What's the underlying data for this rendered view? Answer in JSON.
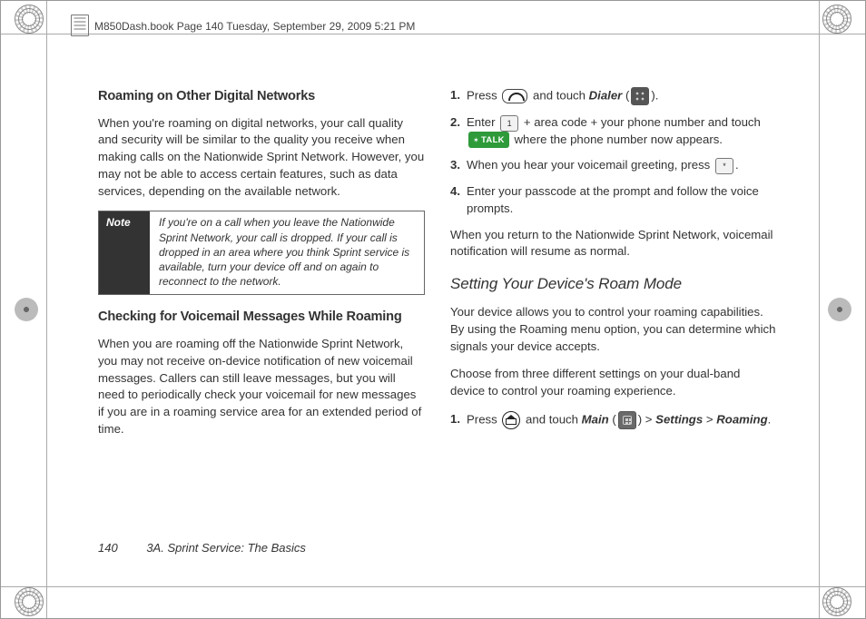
{
  "header": "M850Dash.book  Page 140  Tuesday, September 29, 2009  5:21 PM",
  "page_number": "140",
  "chapter": "3A. Sprint Service: The Basics",
  "left": {
    "h1": "Roaming on Other Digital Networks",
    "p1": "When you're roaming on digital networks, your call quality and security will be similar to the quality you receive when making calls on the Nationwide Sprint Network. However, you may not be able to access certain features, such as data services, depending on the available network.",
    "note_label": "Note",
    "note_text": "If you're on a call when you leave the Nationwide Sprint Network, your call is dropped. If your call is dropped in an area where you think Sprint service is available, turn your device off and on again to reconnect to the network.",
    "h2": "Checking for Voicemail Messages While Roaming",
    "p2": "When you are roaming off the Nationwide Sprint Network, you may not receive on-device notification of new voicemail messages. Callers can still leave messages, but you will need to periodically check your voicemail for new messages if you are in a roaming service area for an extended period of time."
  },
  "right": {
    "step1_a": "Press ",
    "step1_b": " and touch ",
    "step1_dialer": "Dialer",
    "step1_c": " (",
    "step1_d": ").",
    "step2_a": "Enter ",
    "step2_b": " + area code + your phone number and touch ",
    "step2_talk": "TALK",
    "step2_c": " where the phone number now appears.",
    "step3_a": "When you hear your voicemail greeting, press ",
    "step3_key": "*",
    "step3_b": ".",
    "step4": "Enter your passcode at the prompt and follow the voice prompts.",
    "p_after": "When you return to the Nationwide Sprint Network, voicemail notification will resume as normal.",
    "h3": "Setting Your Device's Roam Mode",
    "p3": "Your device allows you to control your roaming capabilities. By using the Roaming menu option, you can determine which signals your device accepts.",
    "p4": "Choose from three different settings on your dual-band device to control your roaming experience.",
    "r_step1_a": "Press ",
    "r_step1_b": " and touch ",
    "r_step1_main": "Main",
    "r_step1_c": " (",
    "r_step1_d": ") > ",
    "r_step1_settings": "Settings",
    "r_step1_e": " > ",
    "r_step1_roaming": "Roaming",
    "r_step1_f": "."
  }
}
